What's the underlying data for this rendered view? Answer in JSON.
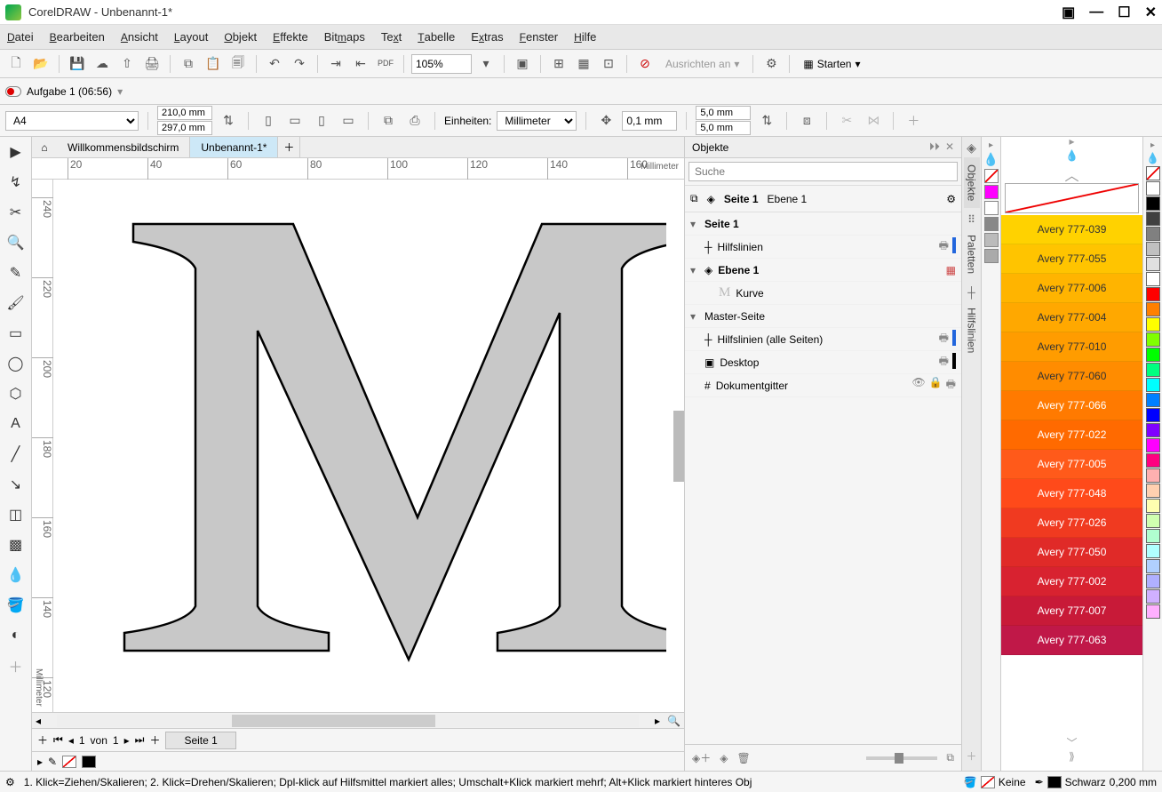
{
  "app": {
    "title": "CorelDRAW - Unbenannt-1*"
  },
  "menu": [
    "Datei",
    "Bearbeiten",
    "Ansicht",
    "Layout",
    "Objekt",
    "Effekte",
    "Bitmaps",
    "Text",
    "Tabelle",
    "Extras",
    "Fenster",
    "Hilfe"
  ],
  "toolbar": {
    "zoom": "105%",
    "ausrichten": "Ausrichten an",
    "starten": "Starten"
  },
  "task": {
    "label": "Aufgabe 1 (06:56)"
  },
  "props": {
    "page_size": "A4",
    "width": "210,0 mm",
    "height": "297,0 mm",
    "units_label": "Einheiten:",
    "units": "Millimeter",
    "nudge": "0,1 mm",
    "dupx": "5,0 mm",
    "dupy": "5,0 mm"
  },
  "doc_tabs": {
    "welcome": "Willkommensbildschirm",
    "active": "Unbenannt-1*"
  },
  "ruler": {
    "unit": "Millimeter",
    "h_ticks": [
      "20",
      "40",
      "60",
      "80",
      "100",
      "120",
      "140",
      "160"
    ],
    "v_ticks": [
      "240",
      "220",
      "200",
      "180",
      "160",
      "140",
      "120"
    ]
  },
  "objects": {
    "title": "Objekte",
    "search_placeholder": "Suche",
    "breadcrumb_page": "Seite 1",
    "breadcrumb_layer": "Ebene 1",
    "tree": {
      "page": "Seite 1",
      "guides": "Hilfslinien",
      "layer": "Ebene 1",
      "curve": "Kurve",
      "master": "Master-Seite",
      "guides_all": "Hilfslinien (alle Seiten)",
      "desktop": "Desktop",
      "docgrid": "Dokumentgitter"
    },
    "side_tabs": [
      "Objekte",
      "Paletten",
      "Hilfslinien"
    ]
  },
  "avery": [
    {
      "label": "Avery 777-039",
      "color": "#ffd200"
    },
    {
      "label": "Avery 777-055",
      "color": "#ffc400"
    },
    {
      "label": "Avery 777-006",
      "color": "#ffb400"
    },
    {
      "label": "Avery 777-004",
      "color": "#ffa800"
    },
    {
      "label": "Avery 777-010",
      "color": "#ff9c00"
    },
    {
      "label": "Avery 777-060",
      "color": "#ff8c00"
    },
    {
      "label": "Avery 777-066",
      "color": "#ff7a00"
    },
    {
      "label": "Avery 777-022",
      "color": "#ff6a00"
    },
    {
      "label": "Avery 777-005",
      "color": "#ff5a1a"
    },
    {
      "label": "Avery 777-048",
      "color": "#ff4a1a"
    },
    {
      "label": "Avery 777-026",
      "color": "#f03a20"
    },
    {
      "label": "Avery 777-050",
      "color": "#e02a28"
    },
    {
      "label": "Avery 777-002",
      "color": "#d82230"
    },
    {
      "label": "Avery 777-007",
      "color": "#c81a38"
    },
    {
      "label": "Avery 777-063",
      "color": "#c01848"
    }
  ],
  "right_palette": [
    "#ffffff",
    "#000000",
    "#404040",
    "#808080",
    "#c0c0c0",
    "#e0e0e0",
    "#ffffff",
    "#ff0000",
    "#ff8000",
    "#ffff00",
    "#80ff00",
    "#00ff00",
    "#00ff80",
    "#00ffff",
    "#0080ff",
    "#0000ff",
    "#8000ff",
    "#ff00ff",
    "#ff0080",
    "#ffb0b0",
    "#ffd0b0",
    "#ffffb0",
    "#d0ffb0",
    "#b0ffd0",
    "#b0ffff",
    "#b0d0ff",
    "#b0b0ff",
    "#d0b0ff",
    "#ffb0ff"
  ],
  "left_palette": [
    "#ff00ff",
    "#ffffff",
    "#808080",
    "#c0c0c0",
    "#a0a0a0"
  ],
  "page_nav": {
    "current": "1",
    "sep": "von",
    "total": "1",
    "tab": "Seite 1"
  },
  "status": {
    "hint": "1. Klick=Ziehen/Skalieren; 2. Klick=Drehen/Skalieren; Dpl-klick auf Hilfsmittel markiert alles; Umschalt+Klick markiert mehrf; Alt+Klick markiert hinteres Obj",
    "fill": "Keine",
    "stroke_color": "Schwarz",
    "stroke_width": "0,200 mm"
  }
}
